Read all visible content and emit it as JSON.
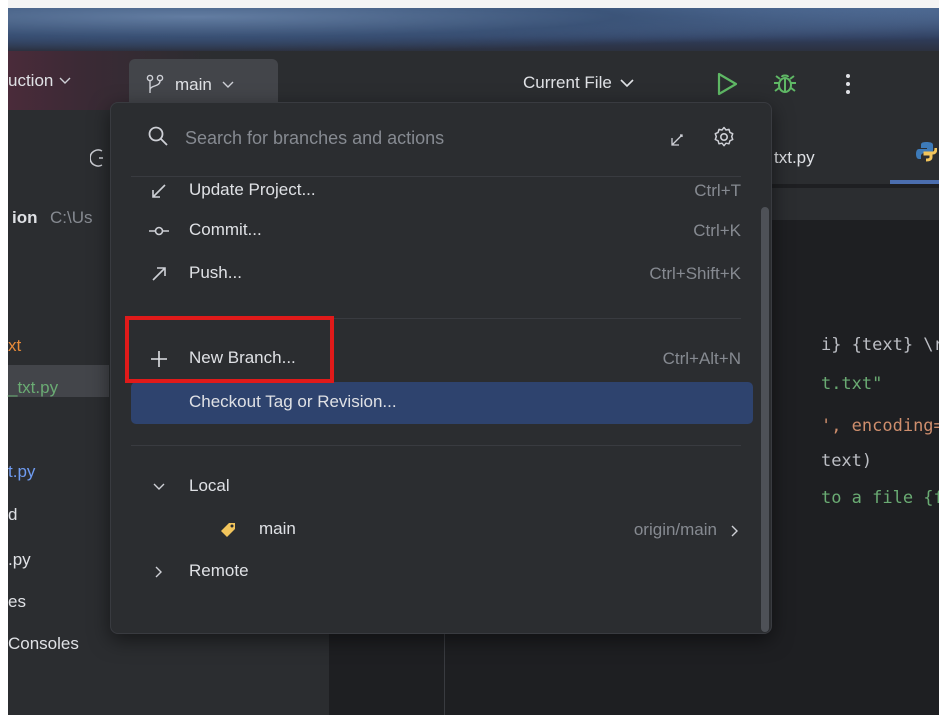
{
  "titlebar": {
    "project_label": "uction",
    "branch_label": "main",
    "run_config_label": "Current File"
  },
  "project_panel": {
    "items": [
      "ion",
      "C:\\Us",
      "xt",
      "_txt.py",
      "t.py",
      "d",
      ".py",
      "es",
      "Consoles"
    ]
  },
  "editor": {
    "tab_label": "txt.py",
    "code_lines": [
      "i} {text} \\r",
      "t.txt\"",
      "', encoding=",
      "text)",
      "to a file {f"
    ]
  },
  "popup": {
    "search_placeholder": "Search for branches and actions",
    "actions": [
      {
        "label": "Update Project...",
        "shortcut": "Ctrl+T"
      },
      {
        "label": "Commit...",
        "shortcut": "Ctrl+K"
      },
      {
        "label": "Push...",
        "shortcut": "Ctrl+Shift+K"
      },
      {
        "label": "New Branch...",
        "shortcut": "Ctrl+Alt+N"
      },
      {
        "label": "Checkout Tag or Revision...",
        "shortcut": ""
      }
    ],
    "local_group": "Local",
    "local_branch": {
      "name": "main",
      "tracking": "origin/main"
    },
    "remote_group": "Remote"
  },
  "colors": {
    "accent": "#2e436e",
    "run_green": "#5fb865",
    "annotation_red": "#e01a1a",
    "tag_yellow": "#f2c55c"
  }
}
